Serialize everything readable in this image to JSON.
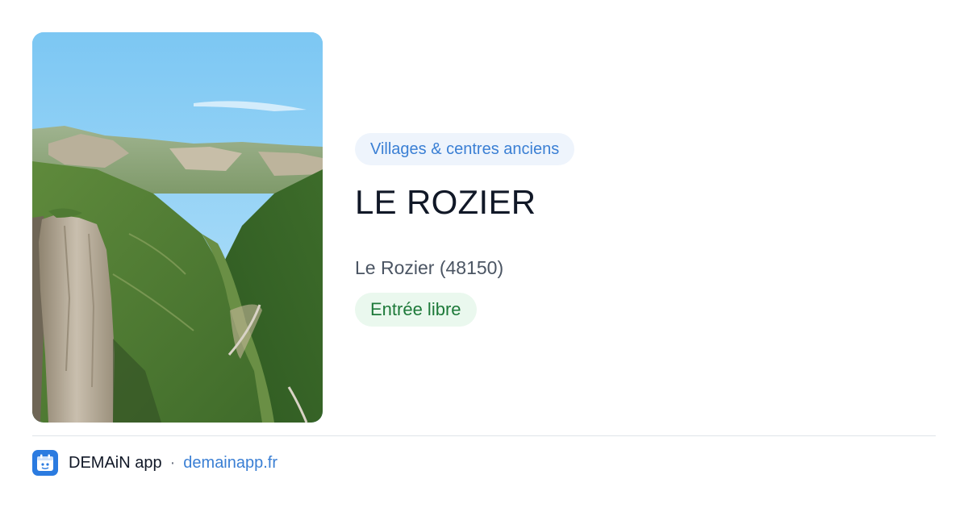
{
  "photo": {
    "icon": "landscape-photo",
    "subject": "Gorges limestone cliffs and valley"
  },
  "category": {
    "label": "Villages & centres anciens",
    "color": "#3a7fd4",
    "background": "#eef4fc"
  },
  "place": {
    "title": "LE ROZIER",
    "location": "Le Rozier (48150)"
  },
  "access": {
    "label": "Entrée libre",
    "color": "#1e7a3a",
    "background": "#eaf8ee"
  },
  "footer": {
    "app_icon": "demain-app-icon",
    "brand": "DEMAiN app",
    "separator": "·",
    "domain": "demainapp.fr",
    "accent": "#2b7be0"
  }
}
